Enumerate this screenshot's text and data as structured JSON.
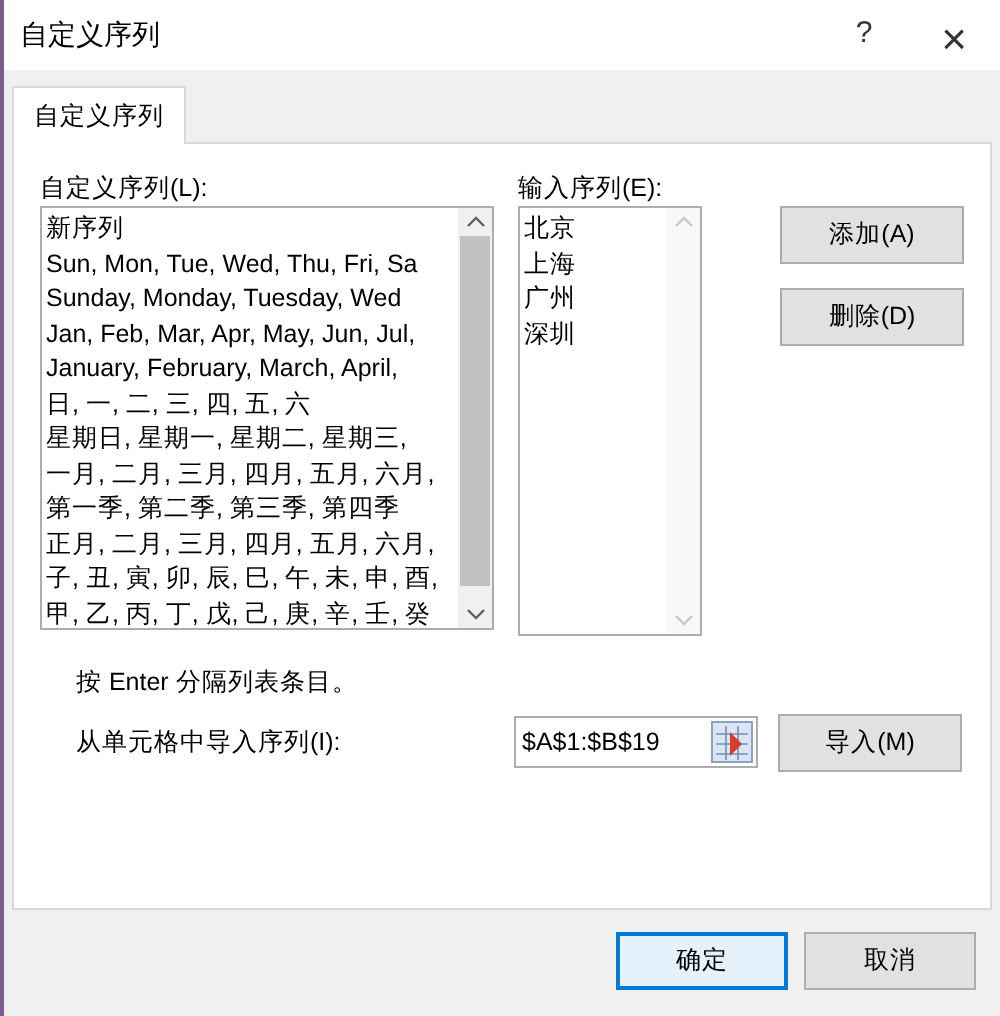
{
  "window": {
    "title": "自定义序列",
    "help": "?",
    "close": "×"
  },
  "tabs": [
    {
      "label": "自定义序列",
      "selected": true
    }
  ],
  "custom_lists": {
    "label": "自定义序列(L):",
    "items": [
      {
        "text": "新序列",
        "selected": false
      },
      {
        "text": "Sun, Mon, Tue, Wed, Thu, Fri, Sa",
        "selected": false
      },
      {
        "text": "Sunday, Monday, Tuesday, Wed",
        "selected": false
      },
      {
        "text": "Jan, Feb, Mar, Apr, May, Jun, Jul,",
        "selected": false
      },
      {
        "text": "January, February, March, April,",
        "selected": false
      },
      {
        "text": "日, 一, 二, 三, 四, 五, 六",
        "selected": false
      },
      {
        "text": "星期日, 星期一, 星期二, 星期三,",
        "selected": false
      },
      {
        "text": "一月, 二月, 三月, 四月, 五月, 六月,",
        "selected": false
      },
      {
        "text": "第一季, 第二季, 第三季, 第四季",
        "selected": false
      },
      {
        "text": "正月, 二月, 三月, 四月, 五月, 六月,",
        "selected": false
      },
      {
        "text": "子, 丑, 寅, 卯, 辰, 巳, 午, 未, 申, 酉,",
        "selected": false
      },
      {
        "text": "甲, 乙, 丙, 丁, 戊, 己, 庚, 辛, 壬, 癸",
        "selected": false
      }
    ]
  },
  "list_entries": {
    "label": "输入序列(E):",
    "lines": [
      "北京",
      "上海",
      "广州",
      "深圳"
    ]
  },
  "side_buttons": [
    "添加(A)",
    "删除(D)"
  ],
  "hint": "按 Enter 分隔列表条目。",
  "import": {
    "label": "从单元格中导入序列(I):",
    "value": "$A$1:$B$19",
    "button": "导入(M)"
  },
  "footer_buttons": [
    "确定",
    "取消"
  ]
}
